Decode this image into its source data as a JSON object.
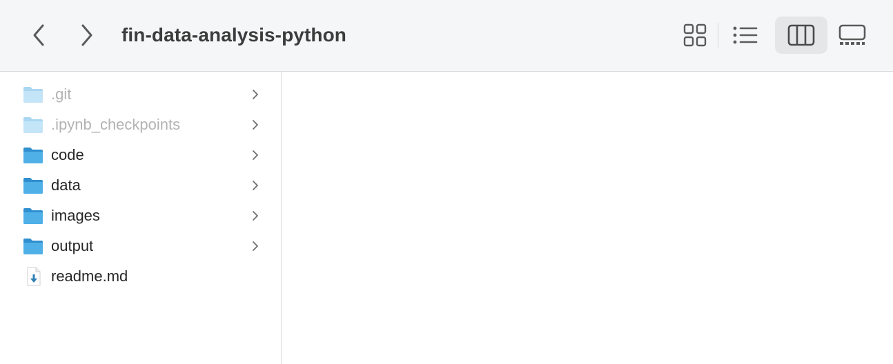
{
  "window": {
    "title": "fin-data-analysis-python"
  },
  "toolbar": {
    "back_icon": "chevron-left-icon",
    "forward_icon": "chevron-right-icon",
    "views": [
      {
        "name": "icons-view",
        "icon": "grid-icon",
        "active": false
      },
      {
        "name": "list-view",
        "icon": "list-icon",
        "active": false
      },
      {
        "name": "columns-view",
        "icon": "columns-icon",
        "active": true
      },
      {
        "name": "gallery-view",
        "icon": "gallery-icon",
        "active": false
      }
    ]
  },
  "files": [
    {
      "name": ".git",
      "kind": "folder",
      "hidden": true
    },
    {
      "name": ".ipynb_checkpoints",
      "kind": "folder",
      "hidden": true
    },
    {
      "name": "code",
      "kind": "folder",
      "hidden": false
    },
    {
      "name": "data",
      "kind": "folder",
      "hidden": false
    },
    {
      "name": "images",
      "kind": "folder",
      "hidden": false
    },
    {
      "name": "output",
      "kind": "folder",
      "hidden": false
    },
    {
      "name": "readme.md",
      "kind": "file",
      "hidden": false
    }
  ],
  "colors": {
    "folder_blue": "#4fb0e8",
    "folder_blue_dim": "#bfe2f6",
    "toolbar_bg": "#f4f6f7",
    "active_view_bg": "#e4e6e8"
  }
}
